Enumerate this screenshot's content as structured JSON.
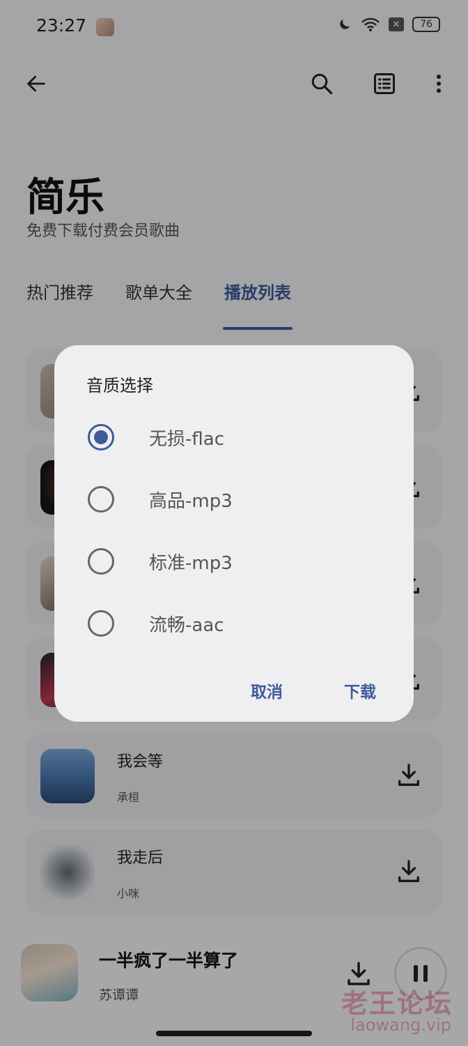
{
  "status_bar": {
    "time": "23:27",
    "battery": "76",
    "icons": [
      "moon-icon",
      "wifi-icon",
      "sim-x-icon",
      "battery-icon"
    ]
  },
  "app": {
    "title": "简乐",
    "subtitle": "免费下载付费会员歌曲"
  },
  "tabs": [
    {
      "label": "热门推荐",
      "active": false
    },
    {
      "label": "歌单大全",
      "active": false
    },
    {
      "label": "播放列表",
      "active": true
    }
  ],
  "songs": [
    {
      "title": "",
      "artist": ""
    },
    {
      "title": "",
      "artist": ""
    },
    {
      "title": "",
      "artist": ""
    },
    {
      "title": "",
      "artist": ""
    },
    {
      "title": "我会等",
      "artist": "承桓"
    },
    {
      "title": "我走后",
      "artist": "小咪"
    }
  ],
  "mini_player": {
    "title": "一半疯了一半算了",
    "artist": "苏谭谭"
  },
  "dialog": {
    "title": "音质选择",
    "options": [
      {
        "label": "无损-flac",
        "selected": true
      },
      {
        "label": "高品-mp3",
        "selected": false
      },
      {
        "label": "标准-mp3",
        "selected": false
      },
      {
        "label": "流畅-aac",
        "selected": false
      }
    ],
    "cancel_label": "取消",
    "confirm_label": "下载"
  },
  "watermark": {
    "cn": "老王论坛",
    "en": "laowang.vip"
  },
  "colors": {
    "accent": "#3d5a9c",
    "card": "#ececf0",
    "dialog": "#efeff1"
  }
}
